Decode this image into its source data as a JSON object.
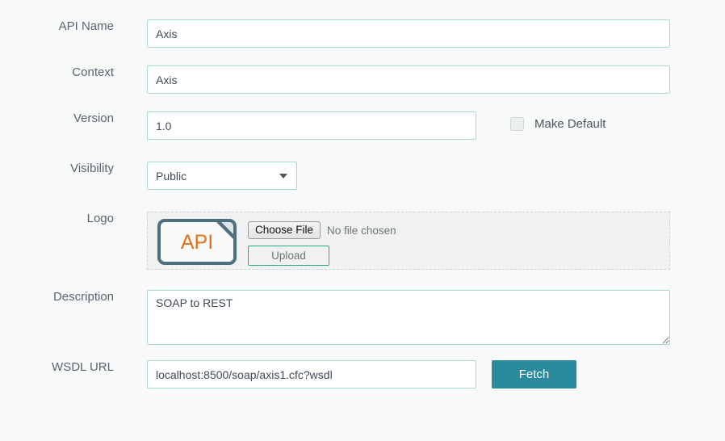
{
  "theme": {
    "page_background": "#f8fafa",
    "input_border": "#a6dbd0",
    "accent_button": "#2a8a9e",
    "upload_border": "#2aa98a",
    "logo_border": "#4d6f80",
    "logo_text_color": "#e2711d",
    "label_color": "#5a6570"
  },
  "form": {
    "api_name": {
      "label": "API Name",
      "value": "Axis",
      "placeholder": ""
    },
    "context": {
      "label": "Context",
      "value": "Axis",
      "placeholder": ""
    },
    "version": {
      "label": "Version",
      "value": "1.0",
      "placeholder": ""
    },
    "make_default": {
      "label": "Make Default",
      "checked": false
    },
    "visibility": {
      "label": "Visibility",
      "value": "Public",
      "options": [
        "Public"
      ]
    },
    "logo": {
      "label": "Logo",
      "icon_text": "API",
      "choose_file_label": "Choose File",
      "no_file_text": "No file chosen",
      "upload_label": "Upload"
    },
    "description": {
      "label": "Description",
      "value": "SOAP to REST",
      "placeholder": ""
    },
    "wsdl_url": {
      "label": "WSDL URL",
      "value": "localhost:8500/soap/axis1.cfc?wsdl",
      "placeholder": "",
      "fetch_label": "Fetch"
    }
  }
}
